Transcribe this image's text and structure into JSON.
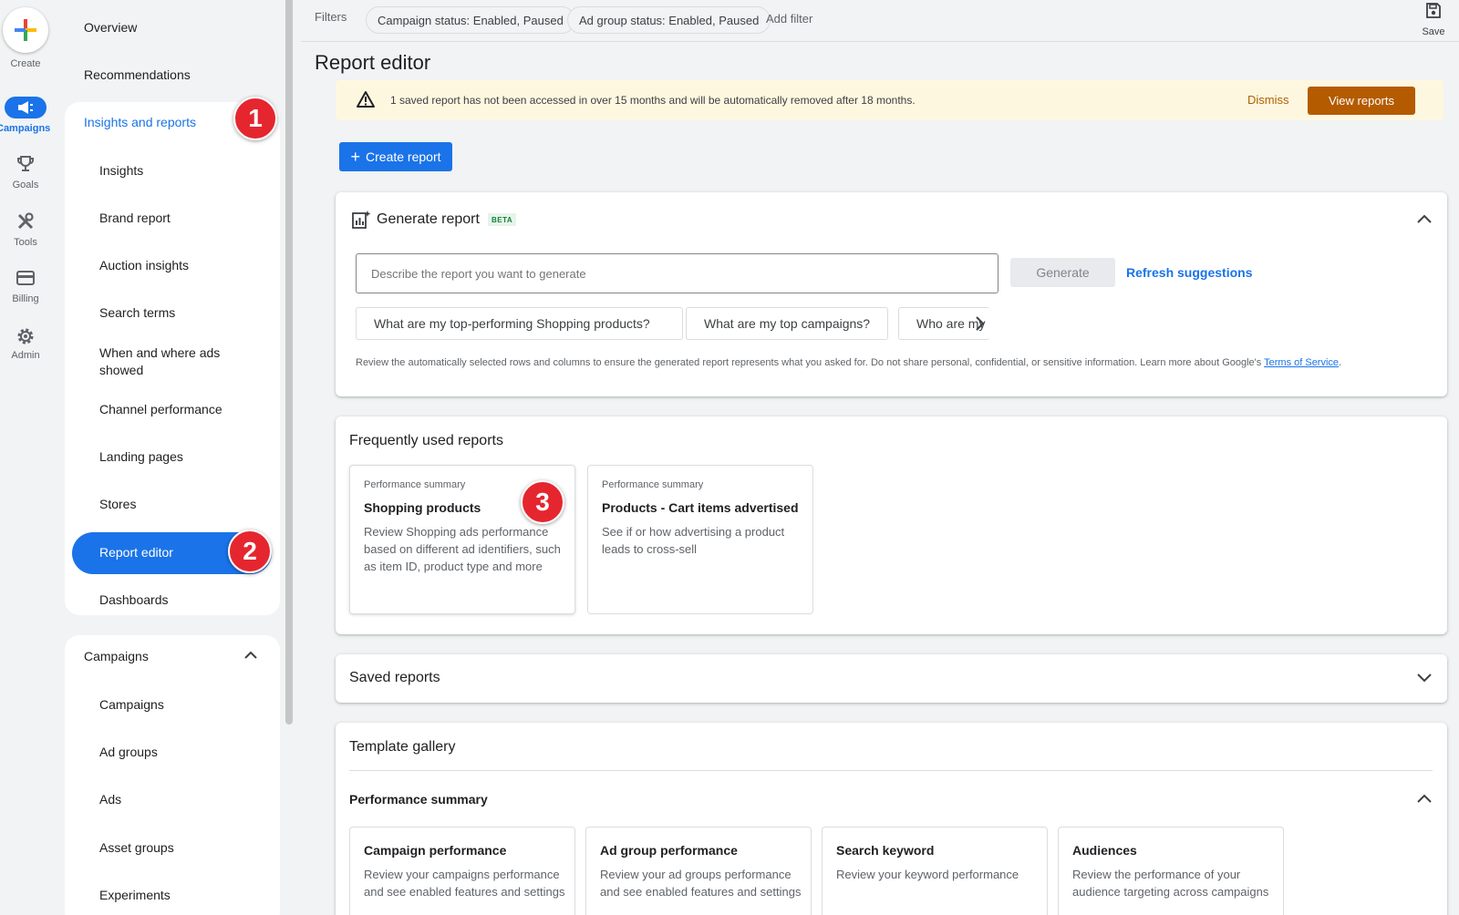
{
  "rail": {
    "create_label": "Create",
    "items": [
      {
        "label": "Campaigns",
        "icon": "megaphone-icon",
        "active": true
      },
      {
        "label": "Goals",
        "icon": "trophy-icon"
      },
      {
        "label": "Tools",
        "icon": "tools-icon"
      },
      {
        "label": "Billing",
        "icon": "credit-card-icon"
      },
      {
        "label": "Admin",
        "icon": "gear-icon"
      }
    ]
  },
  "nav": {
    "overview": "Overview",
    "recommendations": "Recommendations",
    "insights_group": "Insights and reports",
    "insights_items": [
      "Insights",
      "Brand report",
      "Auction insights",
      "Search terms",
      "When and where ads showed",
      "Channel performance",
      "Landing pages",
      "Stores",
      "Report editor",
      "Dashboards"
    ],
    "campaigns_group": "Campaigns",
    "campaigns_items": [
      "Campaigns",
      "Ad groups",
      "Ads",
      "Asset groups",
      "Experiments"
    ]
  },
  "badges": [
    "1",
    "2",
    "3"
  ],
  "filters": {
    "label": "Filters",
    "chips": [
      "Campaign status: Enabled, Paused",
      "Ad group status: Enabled, Paused"
    ],
    "add_filter": "Add filter"
  },
  "save_label": "Save",
  "page_title": "Report editor",
  "alert": {
    "text": "1 saved report has not been accessed in over 15 months and will be automatically removed after 18 months.",
    "dismiss": "Dismiss",
    "view_reports": "View reports"
  },
  "create_report": "Create report",
  "generate": {
    "title": "Generate report",
    "beta": "BETA",
    "placeholder": "Describe the report you want to generate",
    "button": "Generate",
    "refresh": "Refresh suggestions",
    "suggestions": [
      "What are my top-performing Shopping products?",
      "What are my top campaigns?",
      "Who are my"
    ],
    "disclaimer": "Review the automatically selected rows and columns to ensure the generated report represents what you asked for. Do not share personal, confidential, or sensitive information. Learn more about Google's ",
    "terms": "Terms of Service",
    "period": "."
  },
  "frequent": {
    "title": "Frequently used reports",
    "cards": [
      {
        "kicker": "Performance summary",
        "title": "Shopping products",
        "desc": "Review Shopping ads performance based on different ad identifiers, such as item ID, product type and more"
      },
      {
        "kicker": "Performance summary",
        "title": "Products - Cart items advertised",
        "desc": "See if or how advertising a product leads to cross-sell"
      }
    ]
  },
  "saved_reports": "Saved reports",
  "template": {
    "title": "Template gallery",
    "section": "Performance summary",
    "cards": [
      {
        "title": "Campaign performance",
        "desc": "Review your campaigns performance and see enabled features and settings"
      },
      {
        "title": "Ad group performance",
        "desc": "Review your ad groups performance and see enabled features and settings"
      },
      {
        "title": "Search keyword",
        "desc": "Review your keyword performance"
      },
      {
        "title": "Audiences",
        "desc": "Review the performance of your audience targeting across campaigns"
      }
    ]
  },
  "colors": {
    "accent": "#1a73e8",
    "badge": "#e5262f",
    "warning_button": "#b45b00",
    "alert_bg": "#fef7e0"
  }
}
